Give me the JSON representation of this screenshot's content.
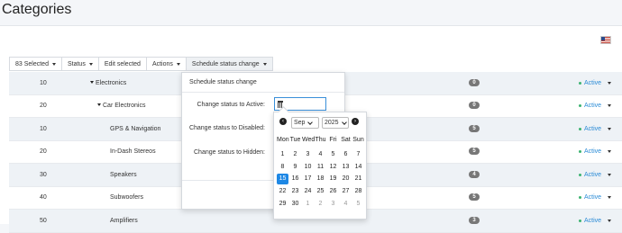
{
  "page": {
    "title": "Categories"
  },
  "toolbar": {
    "selected_label": "83 Selected",
    "status_label": "Status",
    "edit_label": "Edit selected",
    "actions_label": "Actions",
    "schedule_label": "Schedule status change"
  },
  "rows": [
    {
      "position": "10",
      "name": "Electronics",
      "expand": true,
      "count": "0",
      "status": "Active"
    },
    {
      "position": "20",
      "name": "Car Electronics",
      "expand": true,
      "count": "0",
      "status": "Active"
    },
    {
      "position": "10",
      "name": "GPS & Navigation",
      "expand": false,
      "count": "5",
      "status": "Active"
    },
    {
      "position": "20",
      "name": "In-Dash Stereos",
      "expand": false,
      "count": "5",
      "status": "Active"
    },
    {
      "position": "30",
      "name": "Speakers",
      "expand": false,
      "count": "4",
      "status": "Active"
    },
    {
      "position": "40",
      "name": "Subwoofers",
      "expand": false,
      "count": "5",
      "status": "Active"
    },
    {
      "position": "50",
      "name": "Amplifiers",
      "expand": false,
      "count": "3",
      "status": "Active"
    }
  ],
  "schedule_dropdown": {
    "title": "Schedule status change",
    "active_label": "Change status to Active:",
    "disabled_label": "Change status to Disabled:",
    "hidden_label": "Change status to Hidden:"
  },
  "calendar": {
    "month": "Sep",
    "year": "2025",
    "weekdays": [
      "Mon",
      "Tue",
      "Wed",
      "Thu",
      "Fri",
      "Sat",
      "Sun"
    ],
    "weeks": [
      [
        "1",
        "2",
        "3",
        "4",
        "5",
        "6",
        "7"
      ],
      [
        "8",
        "9",
        "10",
        "11",
        "12",
        "13",
        "14"
      ],
      [
        "15",
        "16",
        "17",
        "18",
        "19",
        "20",
        "21"
      ],
      [
        "22",
        "23",
        "24",
        "25",
        "26",
        "27",
        "28"
      ],
      [
        "29",
        "30",
        "1",
        "2",
        "3",
        "4",
        "5"
      ]
    ],
    "selected_day": "15"
  },
  "colors": {
    "accent": "#1e88e5",
    "status_text": "#2a8bd6",
    "status_dot": "#3cb371",
    "badge": "#777777"
  }
}
